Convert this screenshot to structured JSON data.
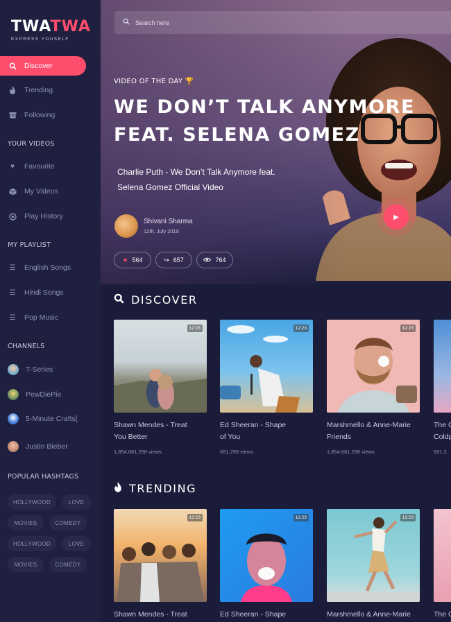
{
  "brand": {
    "logo_part1": "TWA",
    "logo_part2": "TWA",
    "tagline": "EXPRESS YOUSELF"
  },
  "nav": [
    {
      "label": "Discover",
      "icon": "search-icon",
      "active": true
    },
    {
      "label": "Trending",
      "icon": "flame-icon"
    },
    {
      "label": "Following",
      "icon": "archive-icon"
    }
  ],
  "your_videos": {
    "heading": "YOUR VIDEOS",
    "items": [
      {
        "label": "Favourite",
        "icon": "heart-icon"
      },
      {
        "label": "My Videos",
        "icon": "cube-icon"
      },
      {
        "label": "Play History",
        "icon": "history-icon"
      }
    ]
  },
  "my_playlist": {
    "heading": "MY PLAYLIST",
    "items": [
      {
        "label": "English Songs",
        "icon": "list-icon"
      },
      {
        "label": "Hindi Songs",
        "icon": "list-icon"
      },
      {
        "label": "Pop Music",
        "icon": "list-icon"
      }
    ]
  },
  "channels": {
    "heading": "CHANNELS",
    "items": [
      {
        "label": "T-Series"
      },
      {
        "label": "PewDiePie"
      },
      {
        "label": "5-Minute Crafts["
      },
      {
        "label": "Justin Bieber"
      }
    ]
  },
  "hashtags": {
    "heading": "POPULAR HASHTAGS",
    "tags": [
      "HOLLYWOOD",
      "LOVE",
      "MOVIES",
      "COMEDY",
      "HOLLYWOOD",
      "LOVE",
      "MOVIES",
      "COMEDY"
    ]
  },
  "search": {
    "placeholder": "Search here"
  },
  "hero": {
    "kicker": "VIDEO OF THE DAY",
    "title_line1": "WE DON’T TALK ANYMORE",
    "title_line2": "FEAT. SELENA GOMEZ",
    "desc_line1": "Charlie Puth - We Don’t Talk Anymore feat.",
    "desc_line2": "Selena Gomez Official Video",
    "author": "Shivani Sharma",
    "date": "12th, July 2019",
    "likes": "564",
    "shares": "657",
    "views": "764"
  },
  "discover": {
    "heading": "DISCOVER",
    "cards": [
      {
        "title1": "Shawn Mendes - Treat",
        "title2": "You Better",
        "views": "1,854,681,298 views",
        "duration": "12:23"
      },
      {
        "title1": "Ed Sheeran - Shape",
        "title2": "of You",
        "views": "681,298 views",
        "duration": "12:23"
      },
      {
        "title1": "Marshmello & Anne-Marie",
        "title2": "Friends",
        "views": "1,854,681,298 views",
        "duration": "12:23"
      },
      {
        "title1": "The C",
        "title2": "Coldp",
        "views": "681,2"
      }
    ]
  },
  "trending": {
    "heading": "TRENDING",
    "cards": [
      {
        "title1": "Shawn Mendes - Treat",
        "duration": "12:23"
      },
      {
        "title1": "Ed Sheeran - Shape",
        "duration": "12:23"
      },
      {
        "title1": "Marshmello & Anne-Marie",
        "duration": "12:23"
      },
      {
        "title1": "The C"
      }
    ]
  },
  "colors": {
    "accent": "#ff4d6d",
    "sidebar_bg": "#1f2040",
    "page_bg": "#1b1c3a"
  }
}
